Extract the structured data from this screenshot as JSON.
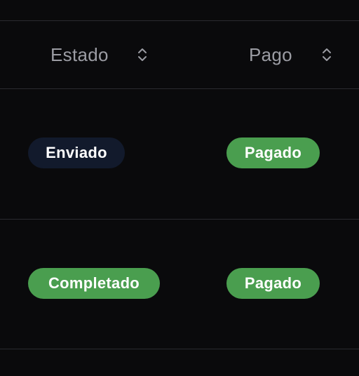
{
  "table": {
    "columns": [
      {
        "label": "Estado",
        "sort_icon": "sort-updown-icon"
      },
      {
        "label": "Pago",
        "sort_icon": "sort-updown-icon"
      }
    ],
    "rows": [
      {
        "estado": "Enviado",
        "pago": "Pagado"
      },
      {
        "estado": "Completado",
        "pago": "Pagado"
      }
    ]
  },
  "colors": {
    "background": "#0a0a0c",
    "divider": "#2a2b30",
    "header_text": "#9b9ca3",
    "badge_enviado": "#121a2c",
    "badge_success": "#4a9e4f",
    "badge_text": "#ffffff"
  }
}
